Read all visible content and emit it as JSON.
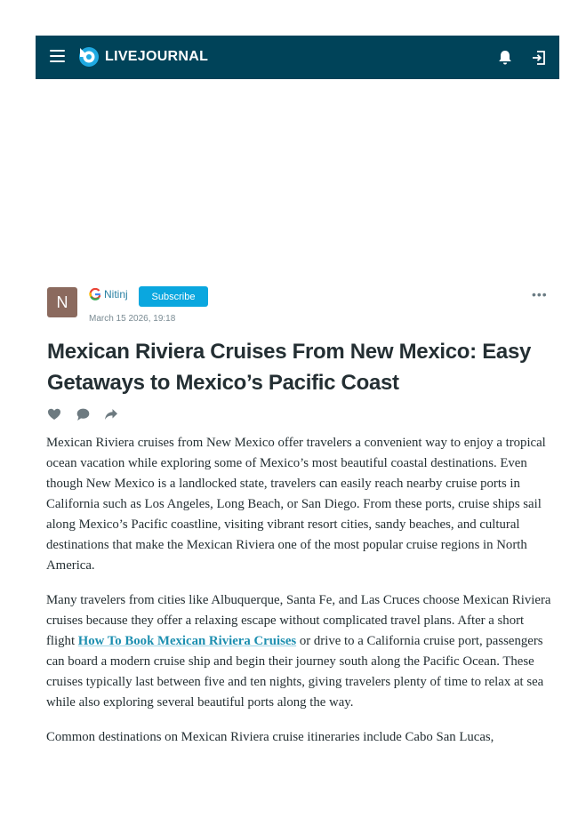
{
  "header": {
    "logo_text": "LIVEJOURNAL",
    "background": "#004359",
    "icons": [
      "menu-icon",
      "livejournal-logo-icon",
      "bell-icon",
      "login-icon"
    ]
  },
  "author": {
    "avatar_letter": "N",
    "avatar_color": "#8b6a5e",
    "name": "Nitinj",
    "subscribe_label": "Subscribe",
    "date": "March 15 2026, 19:18",
    "more_label": "•••"
  },
  "post": {
    "title": "Mexican Riviera Cruises From New Mexico: Easy Getaways to Mexico’s Pacific Coast",
    "paragraph_1": "Mexican Riviera cruises from New Mexico offer travelers a convenient way to enjoy a tropical ocean vacation while exploring some of Mexico’s most beautiful coastal destinations. Even though New Mexico is a landlocked state, travelers can easily reach nearby cruise ports in California such as Los Angeles, Long Beach, or San Diego. From these ports, cruise ships sail along Mexico’s Pacific coastline, visiting vibrant resort cities, sandy beaches, and cultural destinations that make the Mexican Riviera one of the most popular cruise regions in North America.",
    "paragraph_2_before": "Many travelers from cities like Albuquerque, Santa Fe, and Las Cruces choose Mexican Riviera cruises because they offer a relaxing escape without complicated travel plans. After a short flight ",
    "paragraph_2_link": "How To Book Mexican Riviera Cruises",
    "paragraph_2_after": " or drive to a California cruise port, passengers can board a modern cruise ship and begin their journey south along the Pacific Ocean. These cruises typically last between five and ten nights, giving travelers plenty of time to relax at sea while also exploring several beautiful ports along the way.",
    "paragraph_3": "Common destinations on Mexican Riviera cruise itineraries include Cabo San Lucas,"
  },
  "colors": {
    "accent": "#0aa7df",
    "link": "#1d8fb0",
    "text": "#242f33"
  }
}
